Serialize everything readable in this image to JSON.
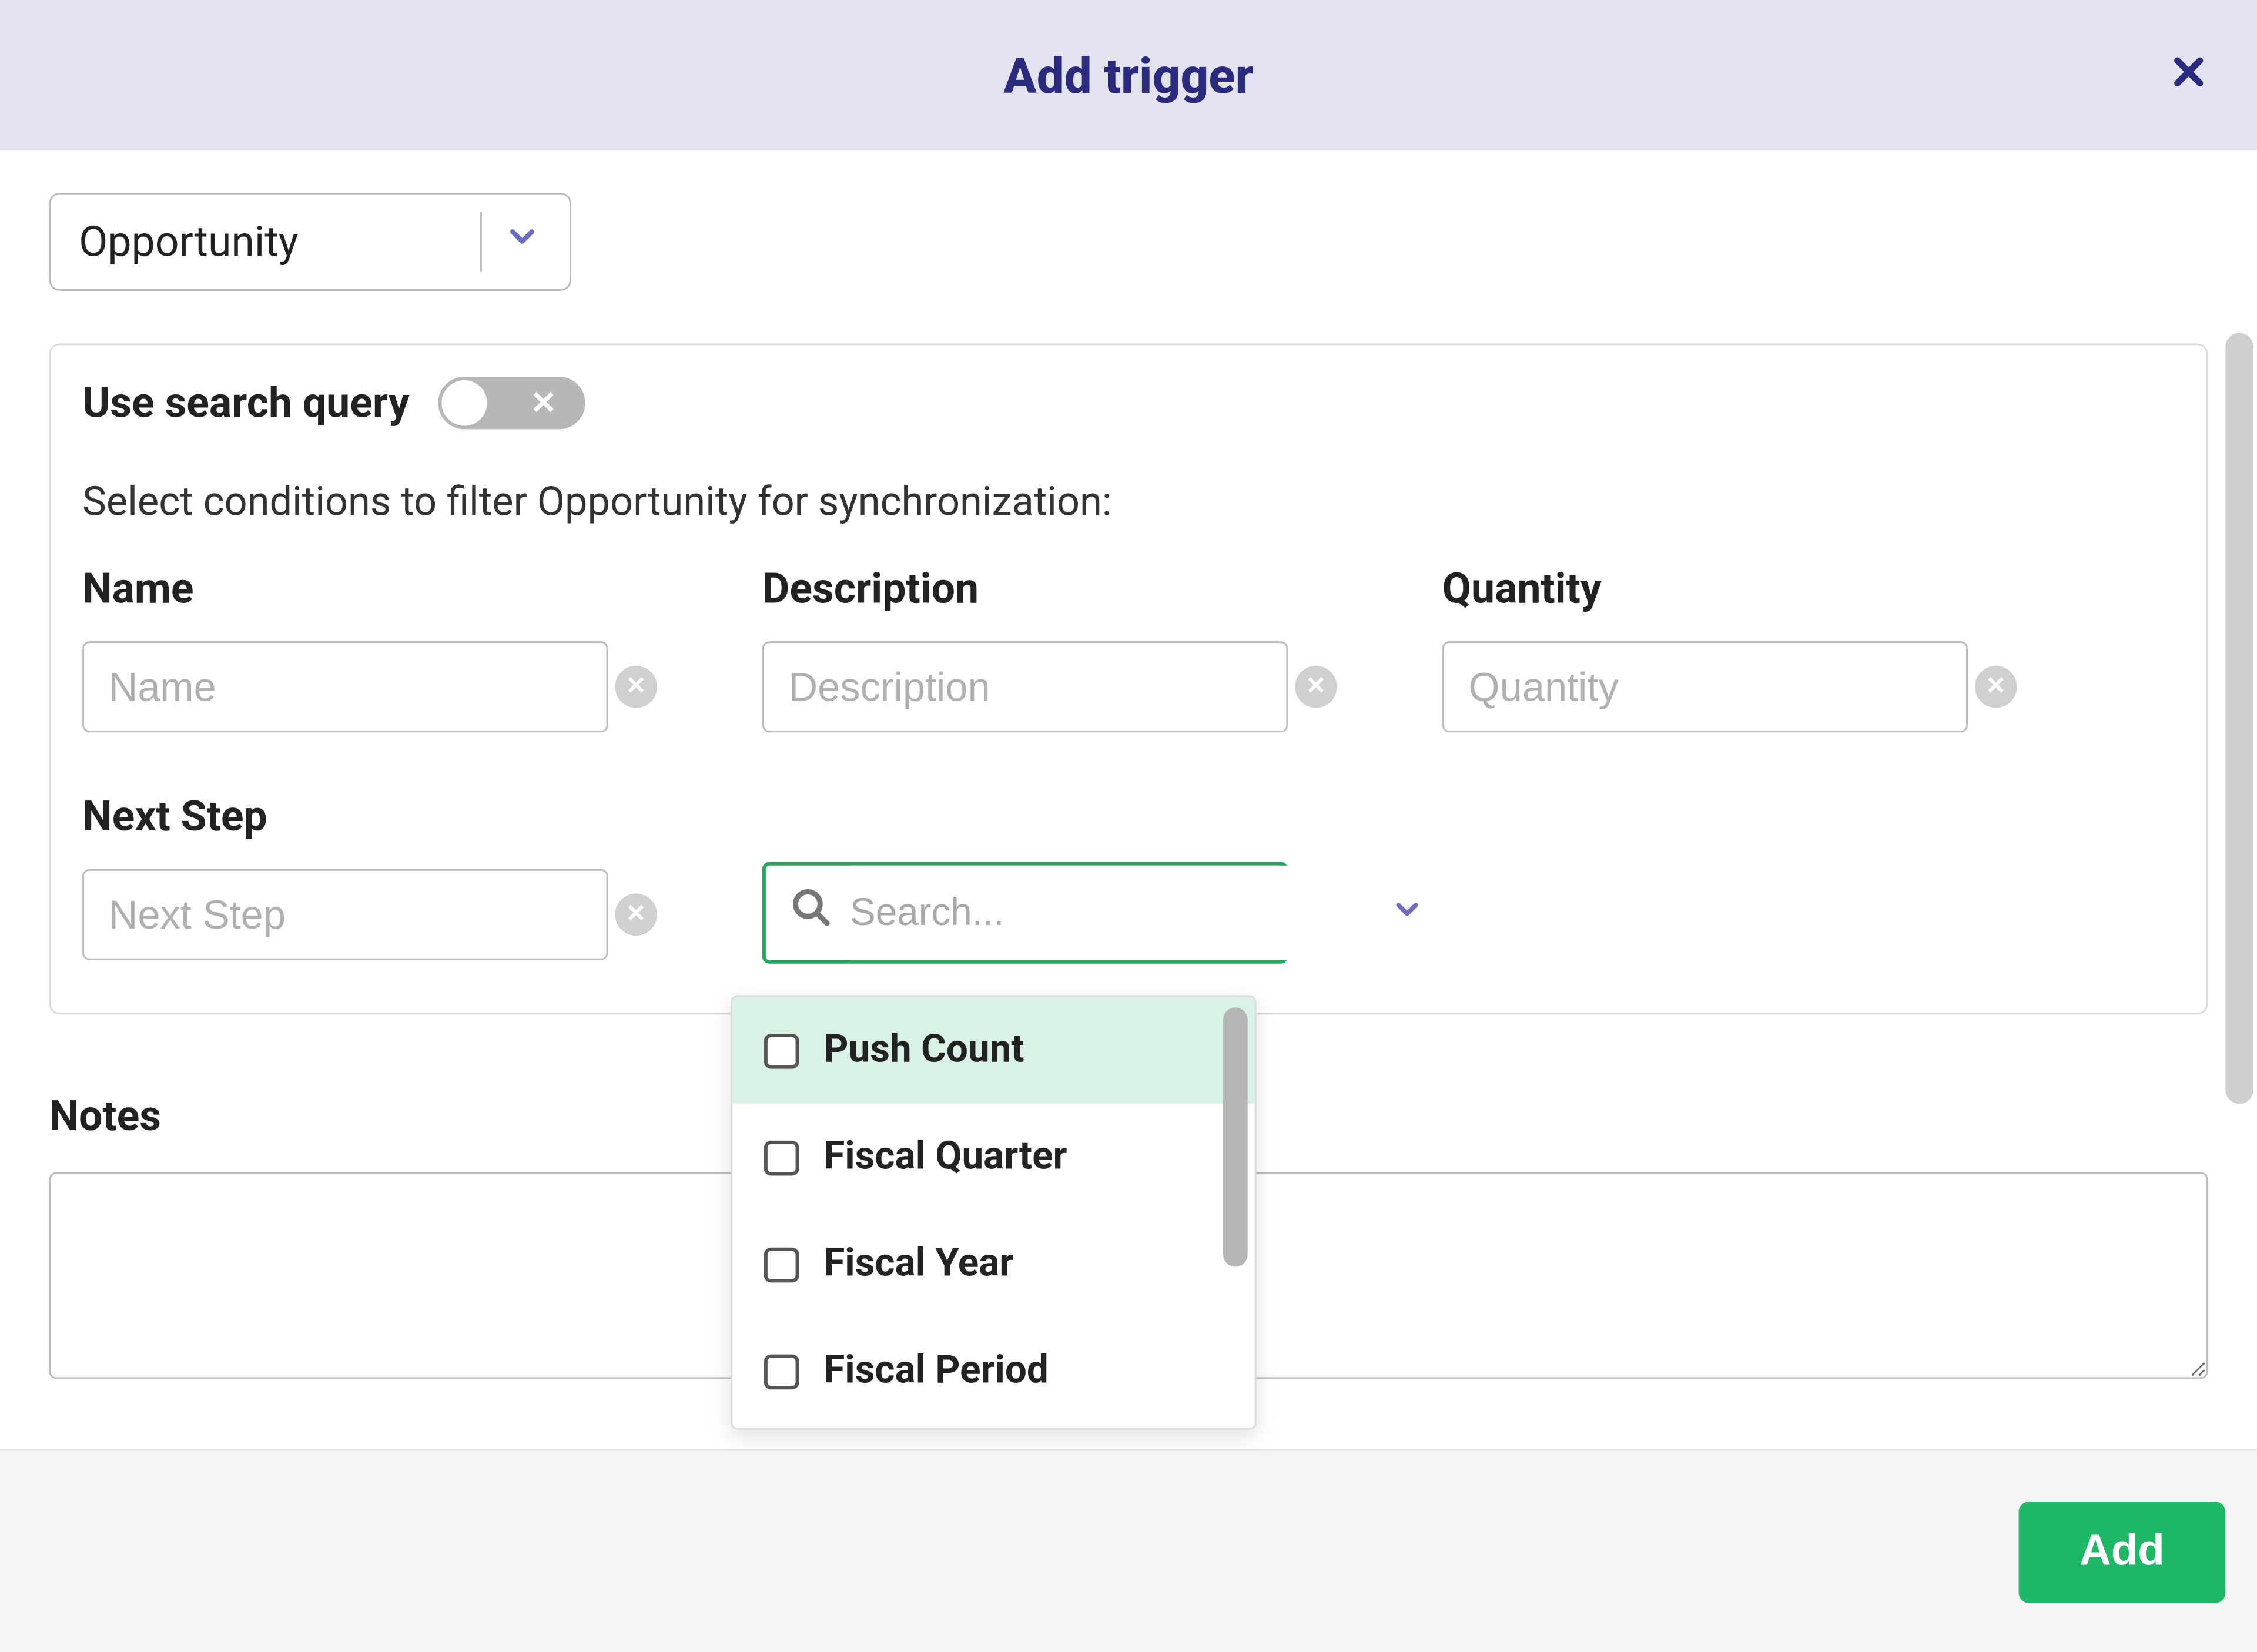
{
  "modal": {
    "title": "Add trigger"
  },
  "entitySelect": {
    "value": "Opportunity"
  },
  "panel": {
    "switch": {
      "label": "Use search query",
      "on": false
    },
    "helper": "Select conditions to filter Opportunity for synchronization:",
    "fields": {
      "name": {
        "label": "Name",
        "placeholder": "Name"
      },
      "description": {
        "label": "Description",
        "placeholder": "Description"
      },
      "quantity": {
        "label": "Quantity",
        "placeholder": "Quantity"
      },
      "nextStep": {
        "label": "Next Step",
        "placeholder": "Next Step"
      }
    },
    "search": {
      "placeholder": "Search..."
    },
    "dropdown": {
      "options": [
        {
          "label": "Push Count",
          "highlighted": true
        },
        {
          "label": "Fiscal Quarter",
          "highlighted": false
        },
        {
          "label": "Fiscal Year",
          "highlighted": false
        },
        {
          "label": "Fiscal Period",
          "highlighted": false
        }
      ]
    }
  },
  "notes": {
    "label": "Notes"
  },
  "footer": {
    "addLabel": "Add"
  }
}
